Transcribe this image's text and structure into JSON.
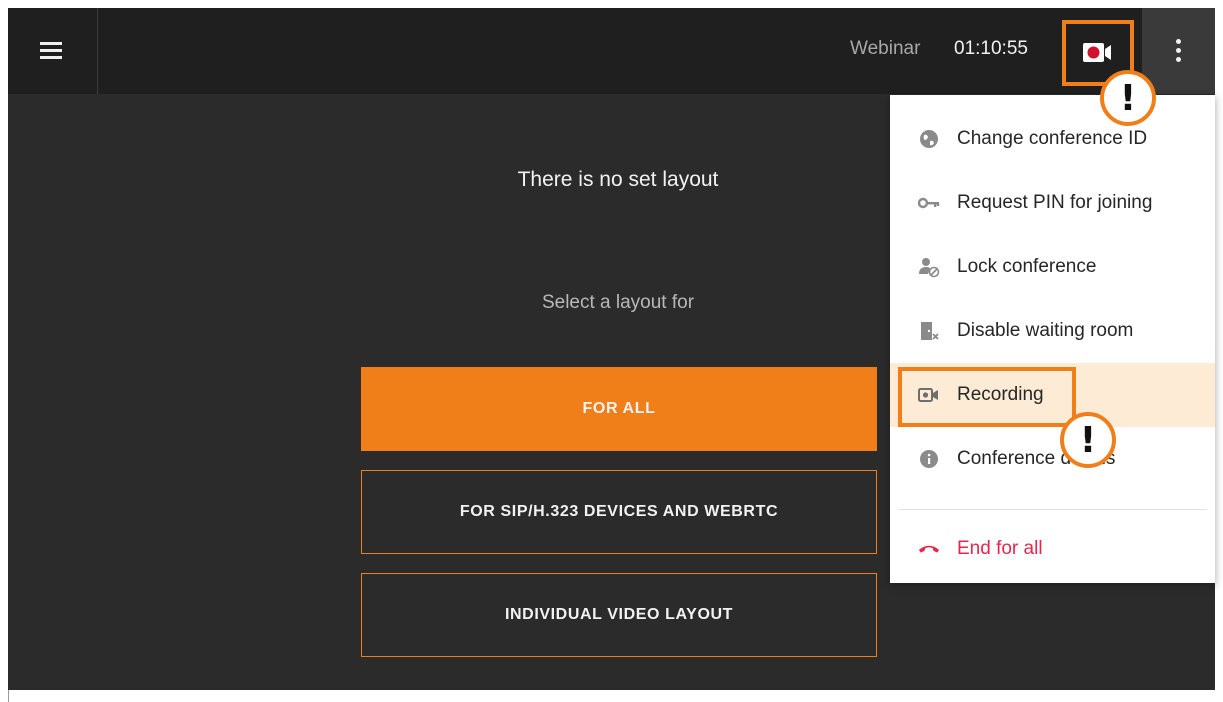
{
  "header": {
    "mode_label": "Webinar",
    "timer": "01:10:55",
    "icons": {
      "menu": "hamburger-menu-icon",
      "recording": "video-camera-recording-icon",
      "more": "more-vertical-icon"
    }
  },
  "main": {
    "title": "There is no set layout",
    "select_label": "Select a layout for",
    "buttons": [
      {
        "label": "FOR ALL"
      },
      {
        "label": "FOR SIP/H.323 DEVICES AND WEBRTC"
      },
      {
        "label": "INDIVIDUAL VIDEO LAYOUT"
      }
    ]
  },
  "menu": {
    "items": [
      {
        "label": "Change conference ID",
        "icon": "globe-icon"
      },
      {
        "label": "Request PIN for joining",
        "icon": "key-icon"
      },
      {
        "label": "Lock conference",
        "icon": "lock-person-icon"
      },
      {
        "label": "Disable waiting room",
        "icon": "door-x-icon"
      },
      {
        "label": "Recording",
        "icon": "video-camera-icon"
      },
      {
        "label": "Conference details",
        "icon": "info-icon"
      },
      {
        "label": "End for all",
        "icon": "hang-up-phone-icon"
      }
    ]
  },
  "annotations": {
    "badge_symbol": "!"
  },
  "colors": {
    "accent": "#f07f1a",
    "topbar": "#1f1f1f",
    "content_bg": "#2b2b2b",
    "danger": "#e8264b",
    "highlight_bg": "#fdebd6"
  }
}
